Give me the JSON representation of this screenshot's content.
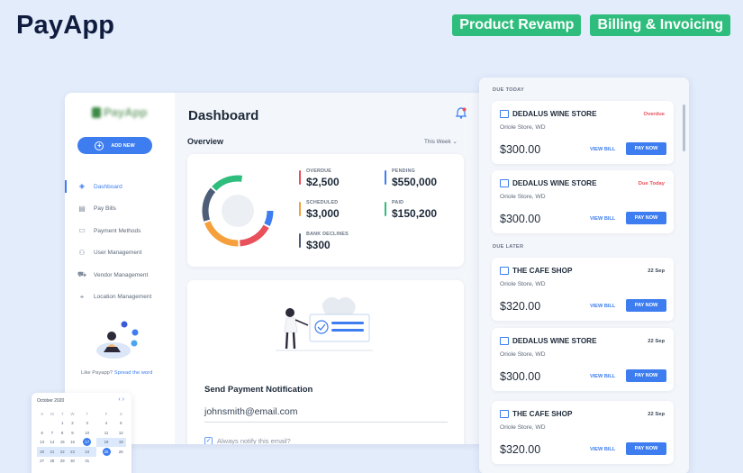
{
  "header": {
    "brand": "PayApp",
    "tags": [
      "Product Revamp",
      "Billing & Invoicing"
    ]
  },
  "sidebar": {
    "logo": "PayApp",
    "add_new": "ADD NEW",
    "items": [
      {
        "label": "Dashboard",
        "icon": "layers-icon",
        "active": true
      },
      {
        "label": "Pay Bills",
        "icon": "bill-icon"
      },
      {
        "label": "Payment Methods",
        "icon": "card-icon"
      },
      {
        "label": "User Management",
        "icon": "users-icon"
      },
      {
        "label": "Vendor Management",
        "icon": "truck-icon"
      },
      {
        "label": "Location Management",
        "icon": "pin-icon"
      }
    ],
    "like_text": "Like Payapp?",
    "spread_link": "Spread the word"
  },
  "dashboard": {
    "title": "Dashboard",
    "overview": "Overview",
    "period": "This Week",
    "stats": [
      {
        "label": "OVERDUE",
        "value": "$2,500",
        "color": "#e8505b"
      },
      {
        "label": "PENDING",
        "value": "$550,000",
        "color": "#3d7df0"
      },
      {
        "label": "SCHEDULED",
        "value": "$3,000",
        "color": "#f5a03c"
      },
      {
        "label": "PAID",
        "value": "$150,200",
        "color": "#2ebd7c"
      },
      {
        "label": "BANK DECLINES",
        "value": "$300",
        "color": "#4e5d78"
      }
    ],
    "notify": {
      "heading": "Send Payment Notification",
      "email": "johnsmith@email.com",
      "checkbox": "Always notify this email?"
    }
  },
  "calendar": {
    "month": "October 2020",
    "days": [
      "S",
      "M",
      "T",
      "W",
      "T",
      "F",
      "S"
    ],
    "weeks": [
      [
        "",
        "",
        "1",
        "2",
        "3",
        "4",
        "5"
      ],
      [
        "6",
        "7",
        "8",
        "9",
        "10",
        "11",
        "12"
      ],
      [
        "13",
        "14",
        "15",
        "16",
        "17",
        "18",
        "19"
      ],
      [
        "20",
        "21",
        "22",
        "23",
        "24",
        "25",
        "26"
      ],
      [
        "27",
        "28",
        "29",
        "30",
        "31",
        "",
        ""
      ]
    ]
  },
  "bills": {
    "due_today": "DUE TODAY",
    "due_later": "DUE LATER",
    "view_label": "VIEW BILL",
    "pay_label": "PAY NOW",
    "items": [
      {
        "name": "DEDALUS WINE STORE",
        "status": "Overdue",
        "status_color": "#e8505b",
        "location": "Oriole Store, WD",
        "amount": "$300.00"
      },
      {
        "name": "DEDALUS WINE STORE",
        "status": "Due Today",
        "status_color": "#e8505b",
        "location": "Oriole Store, WD",
        "amount": "$300.00"
      },
      {
        "name": "THE CAFE SHOP",
        "status": "22 Sep",
        "status_color": "#3b4656",
        "location": "Oriole Store, WD",
        "amount": "$320.00"
      },
      {
        "name": "DEDALUS WINE STORE",
        "status": "22 Sep",
        "status_color": "#3b4656",
        "location": "Oriole Store, WD",
        "amount": "$300.00"
      },
      {
        "name": "THE CAFE SHOP",
        "status": "22 Sep",
        "status_color": "#3b4656",
        "location": "Oriole Store, WD",
        "amount": "$320.00"
      }
    ]
  }
}
